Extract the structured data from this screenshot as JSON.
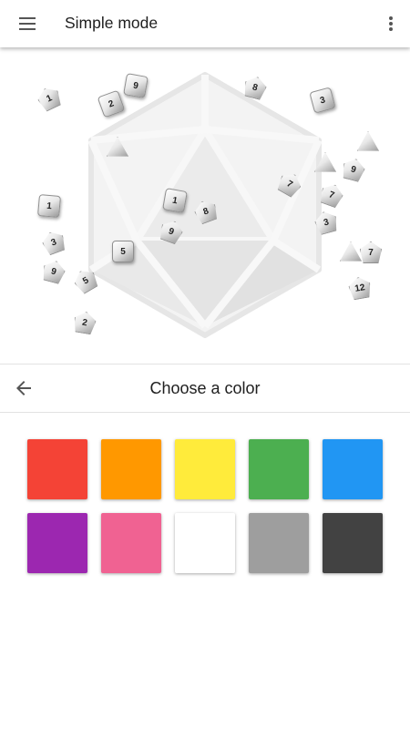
{
  "appbar": {
    "title": "Simple mode",
    "menu_icon": "menu-icon",
    "overflow_icon": "more-vert-icon"
  },
  "stage": {
    "logo_icon": "d20-icon",
    "dice": [
      {
        "label": "1",
        "shape": "oct"
      },
      {
        "label": "2",
        "shape": "cube"
      },
      {
        "label": "9",
        "shape": "cube"
      },
      {
        "label": "8",
        "shape": "oct"
      },
      {
        "label": "3",
        "shape": "cube"
      },
      {
        "label": "",
        "shape": "tri"
      },
      {
        "label": "",
        "shape": "tri"
      },
      {
        "label": "",
        "shape": "tri"
      },
      {
        "label": "9",
        "shape": "oct"
      },
      {
        "label": "1",
        "shape": "cube"
      },
      {
        "label": "1",
        "shape": "cube"
      },
      {
        "label": "8",
        "shape": "oct"
      },
      {
        "label": "7",
        "shape": "oct"
      },
      {
        "label": "7",
        "shape": "oct"
      },
      {
        "label": "3",
        "shape": "oct"
      },
      {
        "label": "9",
        "shape": "oct"
      },
      {
        "label": "5",
        "shape": "cube"
      },
      {
        "label": "3",
        "shape": "oct"
      },
      {
        "label": "9",
        "shape": "oct"
      },
      {
        "label": "5",
        "shape": "oct"
      },
      {
        "label": "2",
        "shape": "oct"
      },
      {
        "label": "",
        "shape": "tri"
      },
      {
        "label": "7",
        "shape": "oct"
      },
      {
        "label": "12",
        "shape": "oct"
      }
    ]
  },
  "chooser": {
    "back_icon": "arrow-back-icon",
    "title": "Choose a color",
    "colors": [
      {
        "name": "red",
        "hex": "#F44336"
      },
      {
        "name": "orange",
        "hex": "#FF9800"
      },
      {
        "name": "yellow",
        "hex": "#FFEB3B"
      },
      {
        "name": "green",
        "hex": "#4CAF50"
      },
      {
        "name": "blue",
        "hex": "#2196F3"
      },
      {
        "name": "purple",
        "hex": "#9C27B0"
      },
      {
        "name": "pink",
        "hex": "#F06292"
      },
      {
        "name": "white",
        "hex": "#FFFFFF"
      },
      {
        "name": "grey",
        "hex": "#9E9E9E"
      },
      {
        "name": "dark-grey",
        "hex": "#424242"
      }
    ]
  }
}
